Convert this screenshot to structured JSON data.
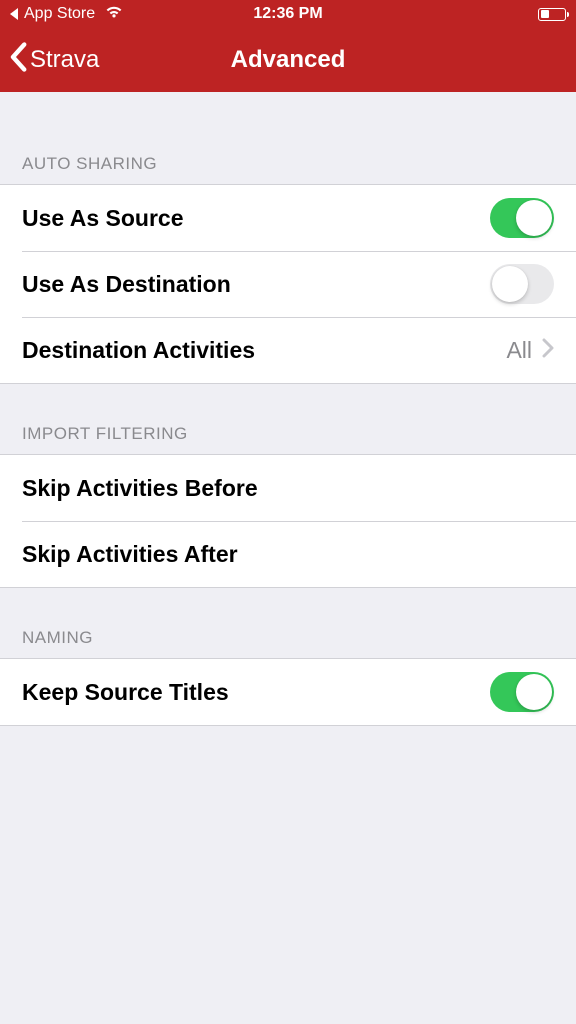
{
  "status_bar": {
    "back_app": "App Store",
    "time": "12:36 PM"
  },
  "nav": {
    "back_label": "Strava",
    "title": "Advanced"
  },
  "sections": {
    "auto_sharing": {
      "header": "AUTO SHARING",
      "use_as_source": {
        "label": "Use As Source",
        "on": true
      },
      "use_as_destination": {
        "label": "Use As Destination",
        "on": false
      },
      "destination_activities": {
        "label": "Destination Activities",
        "value": "All"
      }
    },
    "import_filtering": {
      "header": "IMPORT FILTERING",
      "skip_before": {
        "label": "Skip Activities Before"
      },
      "skip_after": {
        "label": "Skip Activities After"
      }
    },
    "naming": {
      "header": "NAMING",
      "keep_source_titles": {
        "label": "Keep Source Titles",
        "on": true
      }
    }
  },
  "colors": {
    "brand": "#bd2323",
    "switch_on": "#34c759",
    "bg": "#efeff4"
  }
}
